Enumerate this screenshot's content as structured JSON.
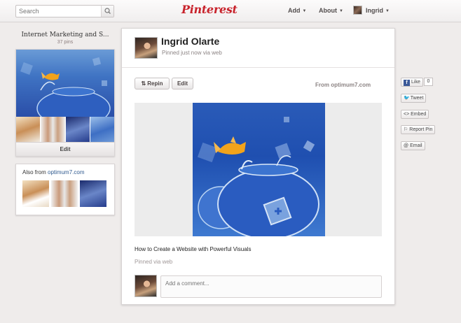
{
  "header": {
    "search_placeholder": "Search",
    "logo_text": "Pinterest",
    "nav": {
      "add": "Add",
      "about": "About",
      "user": "Ingrid"
    }
  },
  "sidebar": {
    "board_title": "Internet Marketing and S...",
    "board_count": "37 pins",
    "board_edit_label": "Edit",
    "also_from_label": "Also from",
    "also_from_source": "optimum7.com"
  },
  "pin": {
    "pinner_name": "Ingrid Olarte",
    "pinned_meta": "Pinned just now via web",
    "repin_label": "Repin",
    "edit_label": "Edit",
    "from_source": "From optimum7.com",
    "description": "How to Create a Website with Powerful Visuals",
    "via": "Pinned via web",
    "comment_placeholder": "Add a comment..."
  },
  "share": {
    "like_label": "Like",
    "like_count": "0",
    "tweet_label": "Tweet",
    "embed_label": "<> Embed",
    "report_label": "Report Pin",
    "email_label": "Email"
  },
  "colors": {
    "brand": "#c8232c",
    "link": "#2f5a8f",
    "facebook": "#3b5998"
  }
}
